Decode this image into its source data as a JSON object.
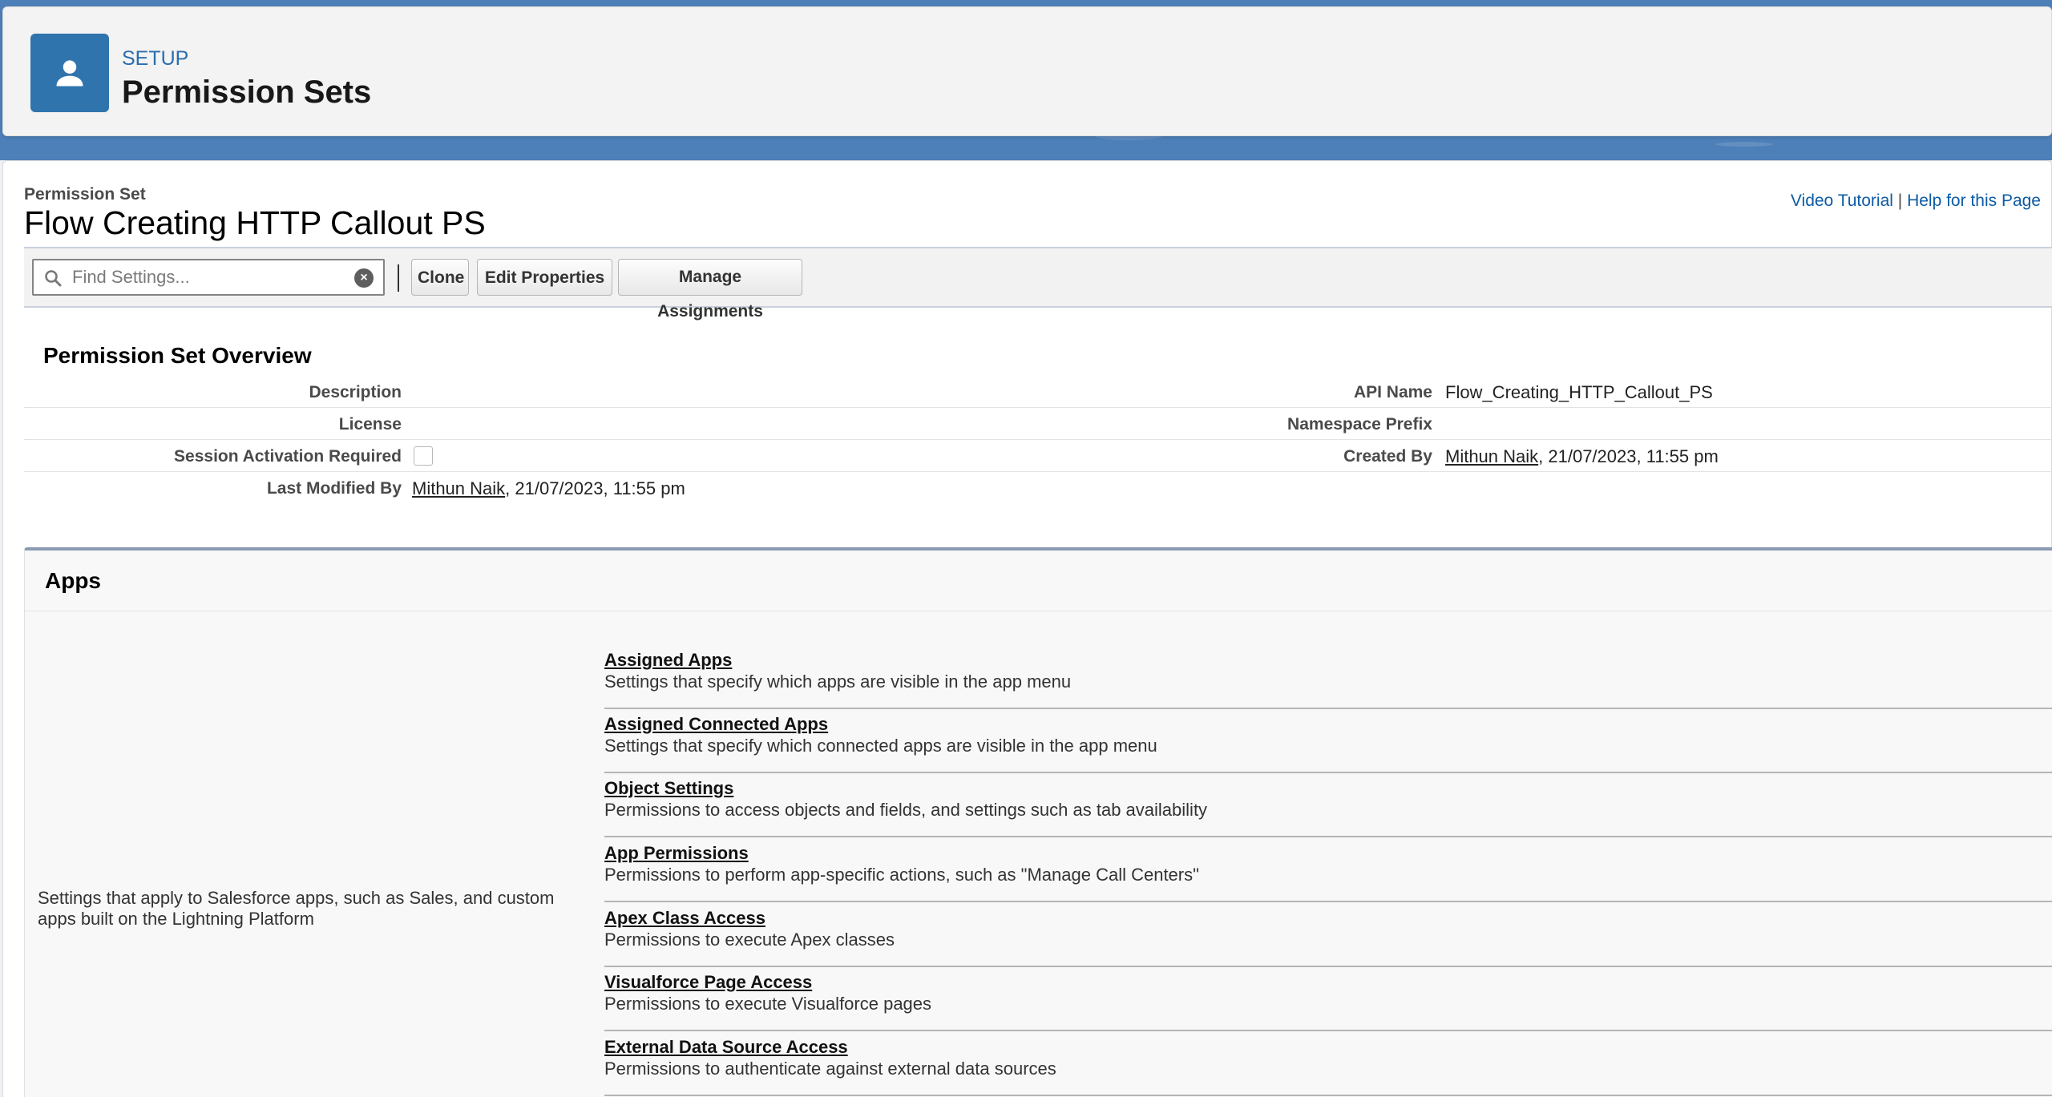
{
  "header": {
    "setup_label": "SETUP",
    "title": "Permission Sets",
    "icon": "user-icon",
    "accent": "#2f74ad"
  },
  "page": {
    "type_label": "Permission Set",
    "title": "Flow Creating HTTP Callout PS",
    "help": {
      "video_tutorial": "Video Tutorial",
      "separator": " | ",
      "help_page": "Help for this Page"
    }
  },
  "toolbar": {
    "search_placeholder": "Find Settings...",
    "clone_label": "Clone",
    "edit_label": "Edit Properties",
    "manage_label": "Manage Assignments"
  },
  "overview": {
    "title": "Permission Set Overview",
    "description_label": "Description",
    "description_value": "",
    "api_name_label": "API Name",
    "api_name_value": "Flow_Creating_HTTP_Callout_PS",
    "license_label": "License",
    "license_value": "",
    "namespace_label": "Namespace Prefix",
    "namespace_value": "",
    "session_label": "Session Activation Required",
    "session_checked": false,
    "created_by_label": "Created By",
    "created_by_user": "Mithun Naik",
    "created_by_date": ", 21/07/2023, 11:55 pm",
    "modified_label": "Last Modified By",
    "modified_user": "Mithun Naik",
    "modified_date": ", 21/07/2023, 11:55 pm"
  },
  "apps": {
    "title": "Apps",
    "description": "Settings that apply to Salesforce apps, such as Sales, and custom apps built on the Lightning Platform",
    "items": [
      {
        "label": "Assigned Apps",
        "desc": "Settings that specify which apps are visible in the app menu"
      },
      {
        "label": "Assigned Connected Apps",
        "desc": "Settings that specify which connected apps are visible in the app menu"
      },
      {
        "label": "Object Settings",
        "desc": "Permissions to access objects and fields, and settings such as tab availability"
      },
      {
        "label": "App Permissions",
        "desc": "Permissions to perform app-specific actions, such as \"Manage Call Centers\""
      },
      {
        "label": "Apex Class Access",
        "desc": "Permissions to execute Apex classes"
      },
      {
        "label": "Visualforce Page Access",
        "desc": "Permissions to execute Visualforce pages"
      },
      {
        "label": "External Data Source Access",
        "desc": "Permissions to authenticate against external data sources"
      }
    ]
  }
}
